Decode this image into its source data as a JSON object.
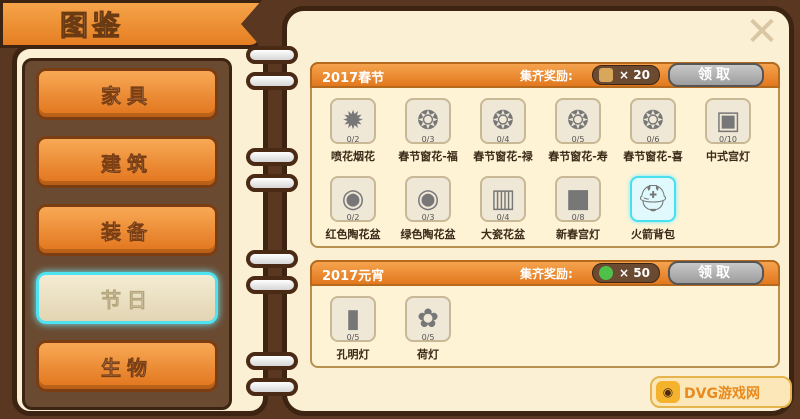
{
  "title": "图鉴",
  "close_icon": "close-icon",
  "categories": [
    {
      "label": "家具",
      "active": false
    },
    {
      "label": "建筑",
      "active": false
    },
    {
      "label": "装备",
      "active": false
    },
    {
      "label": "节日",
      "active": true
    },
    {
      "label": "生物",
      "active": false
    }
  ],
  "sections": [
    {
      "title": "2017春节",
      "reward_label": "集齐奖励:",
      "reward_icon": "horse-icon",
      "reward_count": "× 20",
      "claim_label": "领取",
      "items": [
        {
          "name": "喷花烟花",
          "count": "0/2",
          "icon": "firework-icon",
          "glyph": "✹"
        },
        {
          "name": "春节窗花-福",
          "count": "0/3",
          "icon": "papercut-icon",
          "glyph": "❂"
        },
        {
          "name": "春节窗花-禄",
          "count": "0/4",
          "icon": "papercut-icon",
          "glyph": "❂"
        },
        {
          "name": "春节窗花-寿",
          "count": "0/5",
          "icon": "papercut-icon",
          "glyph": "❂"
        },
        {
          "name": "春节窗花-喜",
          "count": "0/6",
          "icon": "papercut-icon",
          "glyph": "❂"
        },
        {
          "name": "中式宫灯",
          "count": "0/10",
          "icon": "lantern-icon",
          "glyph": "▣"
        },
        {
          "name": "红色陶花盆",
          "count": "0/2",
          "icon": "pot-icon",
          "glyph": "◉"
        },
        {
          "name": "绿色陶花盆",
          "count": "0/3",
          "icon": "pot-icon",
          "glyph": "◉"
        },
        {
          "name": "大瓷花盆",
          "count": "0/4",
          "icon": "vase-icon",
          "glyph": "▥"
        },
        {
          "name": "新春宫灯",
          "count": "0/8",
          "icon": "lantern-icon",
          "glyph": "■"
        },
        {
          "name": "火箭背包",
          "count": "",
          "icon": "rocket-backpack-icon",
          "glyph": "⛑",
          "highlight": true
        }
      ]
    },
    {
      "title": "2017元宵",
      "reward_label": "集齐奖励:",
      "reward_icon": "gem-icon",
      "reward_count": "× 50",
      "claim_label": "领取",
      "items": [
        {
          "name": "孔明灯",
          "count": "0/5",
          "icon": "sky-lantern-icon",
          "glyph": "▮"
        },
        {
          "name": "荷灯",
          "count": "0/5",
          "icon": "lotus-lantern-icon",
          "glyph": "✿"
        }
      ]
    }
  ],
  "watermark": {
    "text": "DVG游戏网",
    "icon": "gamepad-icon"
  }
}
